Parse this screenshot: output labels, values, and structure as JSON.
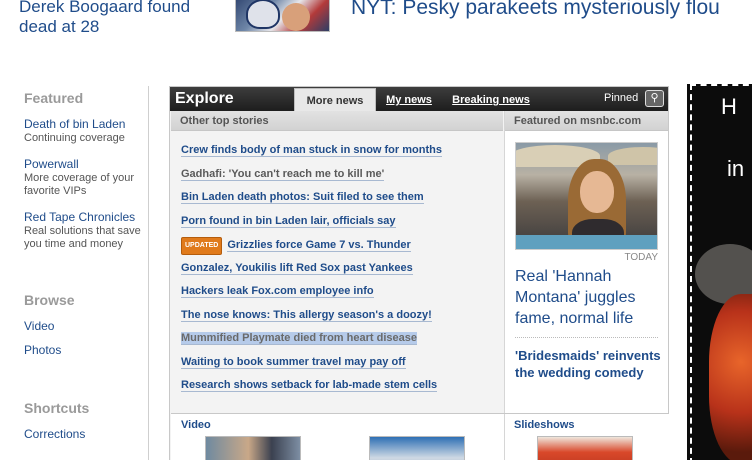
{
  "top": {
    "left_story": "Derek Boogaard found dead at 28",
    "headline": "NYT: Pesky parakeets mysteriously flou"
  },
  "leftnav": {
    "featured": {
      "heading": "Featured",
      "items": [
        {
          "label": "Death of bin Laden",
          "sub": "Continuing coverage"
        },
        {
          "label": "Powerwall",
          "sub": "More coverage of your favorite VIPs"
        },
        {
          "label": "Red Tape Chronicles",
          "sub": "Real solutions that save you time and money"
        }
      ]
    },
    "browse": {
      "heading": "Browse",
      "items": [
        "Video",
        "Photos"
      ]
    },
    "shortcuts": {
      "heading": "Shortcuts",
      "items": [
        "Corrections"
      ]
    }
  },
  "explore": {
    "title": "Explore",
    "tabs": [
      "More news",
      "My news",
      "Breaking news"
    ],
    "active_tab": "More news",
    "pinned_label": "Pinned",
    "pin_icon": "pin-icon",
    "top_stories_heading": "Other top stories",
    "stories": [
      {
        "text": "Crew finds body of man stuck in snow for months",
        "state": "normal"
      },
      {
        "text": "Gadhafi: 'You can't reach me to kill me'",
        "state": "visited"
      },
      {
        "text": "Bin Laden death photos: Suit filed to see them",
        "state": "normal"
      },
      {
        "text": "Porn found in bin Laden lair, officials say",
        "state": "normal"
      },
      {
        "text": "Grizzlies force Game 7 vs. Thunder",
        "state": "normal",
        "badge": "UPDATED"
      },
      {
        "text": "Gonzalez, Youkilis lift Red Sox past Yankees",
        "state": "normal"
      },
      {
        "text": "Hackers leak Fox.com employee info",
        "state": "normal"
      },
      {
        "text": "The nose knows: This allergy season's a doozy!",
        "state": "normal"
      },
      {
        "text": "Mummified Playmate died from heart disease",
        "state": "selected"
      },
      {
        "text": "Waiting to book summer travel may pay off",
        "state": "normal"
      },
      {
        "text": "Research shows setback for lab-made stem cells",
        "state": "normal"
      }
    ],
    "featured_heading": "Featured on msnbc.com",
    "featured_source": "TODAY",
    "featured_head1": "Real 'Hannah Montana' juggles fame, normal life",
    "featured_head2": "'Bridesmaids' reinvents the wedding comedy",
    "bottom": {
      "video_label": "Video",
      "slideshows_label": "Slideshows"
    }
  },
  "ad": {
    "line1": "H",
    "line2": "in"
  },
  "colors": {
    "link_blue": "#1f4c8a",
    "header_dark": "#1d1d1d",
    "badge_orange": "#e07a1b",
    "selection": "#b6cbea"
  }
}
